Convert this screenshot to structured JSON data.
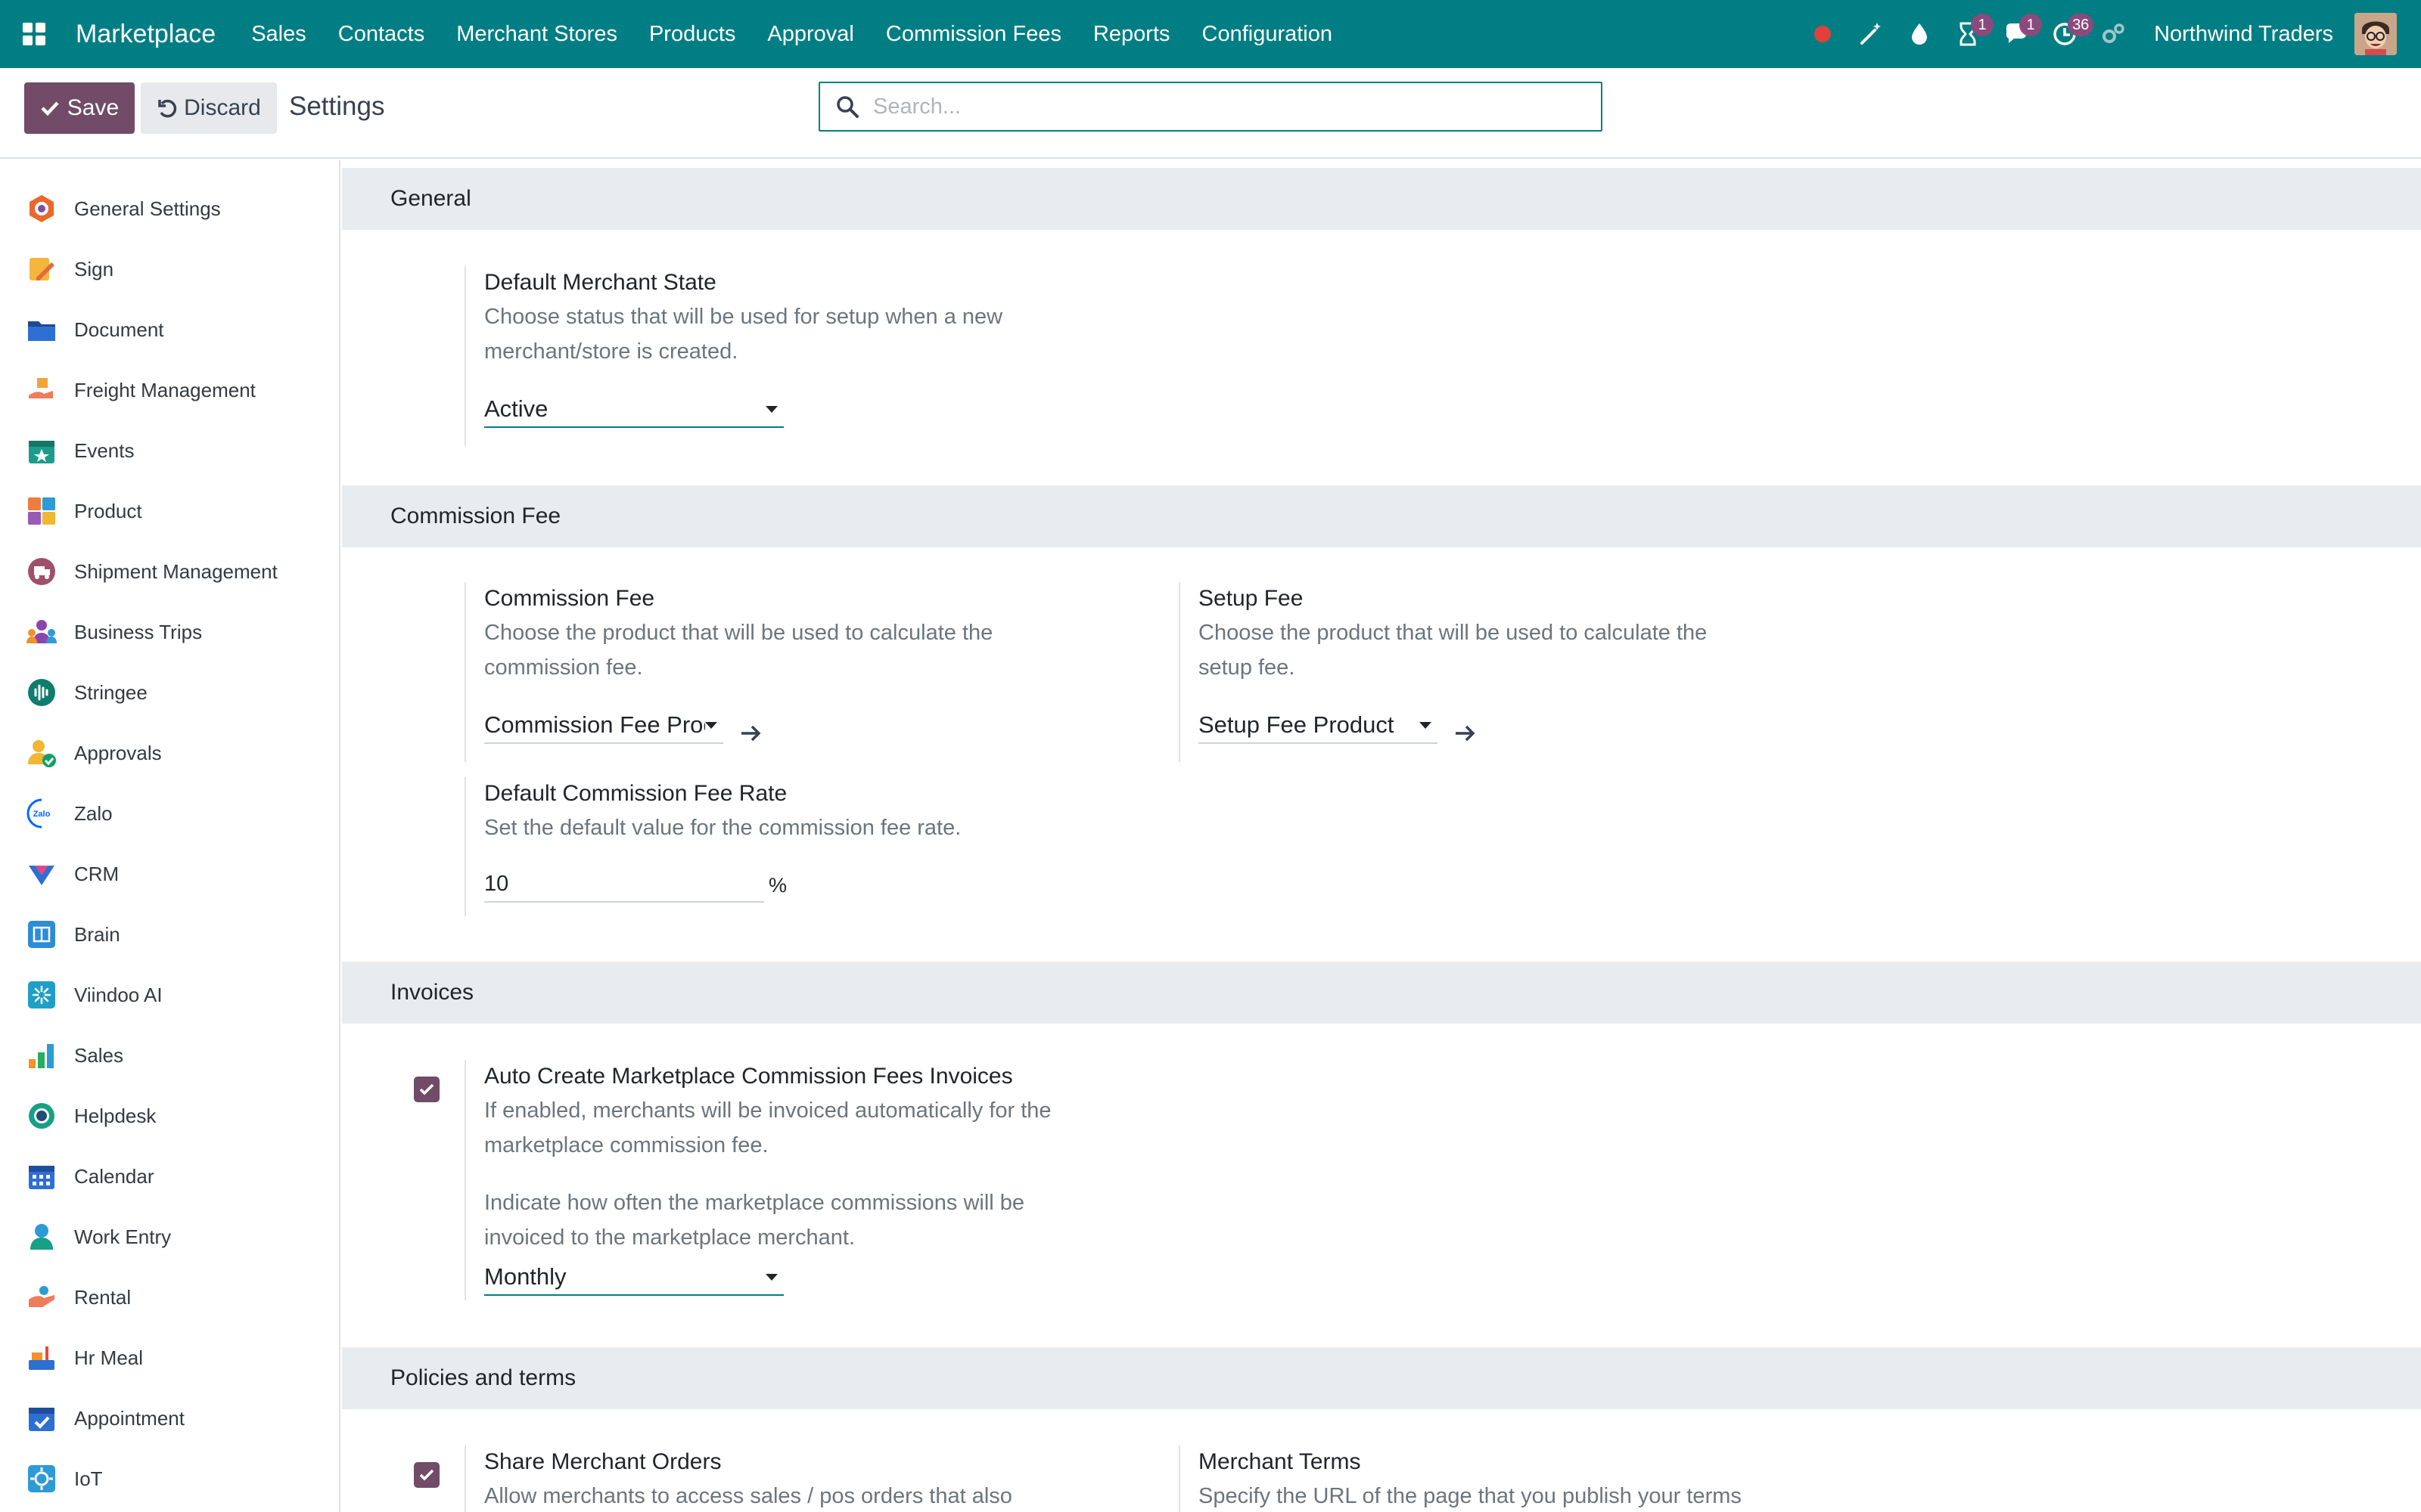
{
  "navbar": {
    "brand": "Marketplace",
    "menu": [
      "Sales",
      "Contacts",
      "Merchant Stores",
      "Products",
      "Approval",
      "Commission Fees",
      "Reports",
      "Configuration"
    ],
    "badges": {
      "activities_timer": "1",
      "messages": "1",
      "clock": "36"
    },
    "company": "Northwind Traders",
    "bg_color": "#017e84"
  },
  "control_panel": {
    "save_label": "Save",
    "discard_label": "Discard",
    "title": "Settings",
    "search_placeholder": "Search..."
  },
  "sidebar": {
    "items": [
      {
        "label": "General Settings",
        "icon": "general-settings-icon"
      },
      {
        "label": "Sign",
        "icon": "sign-icon"
      },
      {
        "label": "Document",
        "icon": "document-icon"
      },
      {
        "label": "Freight Management",
        "icon": "freight-icon"
      },
      {
        "label": "Events",
        "icon": "events-icon"
      },
      {
        "label": "Product",
        "icon": "product-icon"
      },
      {
        "label": "Shipment Management",
        "icon": "shipment-icon"
      },
      {
        "label": "Business Trips",
        "icon": "business-trips-icon"
      },
      {
        "label": "Stringee",
        "icon": "stringee-icon"
      },
      {
        "label": "Approvals",
        "icon": "approvals-icon"
      },
      {
        "label": "Zalo",
        "icon": "zalo-icon"
      },
      {
        "label": "CRM",
        "icon": "crm-icon"
      },
      {
        "label": "Brain",
        "icon": "brain-icon"
      },
      {
        "label": "Viindoo AI",
        "icon": "viindoo-ai-icon"
      },
      {
        "label": "Sales",
        "icon": "sales-icon"
      },
      {
        "label": "Helpdesk",
        "icon": "helpdesk-icon"
      },
      {
        "label": "Calendar",
        "icon": "calendar-icon"
      },
      {
        "label": "Work Entry",
        "icon": "work-entry-icon"
      },
      {
        "label": "Rental",
        "icon": "rental-icon"
      },
      {
        "label": "Hr Meal",
        "icon": "hr-meal-icon"
      },
      {
        "label": "Appointment",
        "icon": "appointment-icon"
      },
      {
        "label": "IoT",
        "icon": "iot-icon"
      }
    ]
  },
  "sections": {
    "general": {
      "title": "General",
      "default_merchant_state": {
        "title": "Default Merchant State",
        "desc_1": "Choose status that will be used for setup when a new",
        "desc_2": "merchant/store is created.",
        "value": "Active"
      }
    },
    "commission_fee": {
      "title": "Commission Fee",
      "commission_fee": {
        "title": "Commission Fee",
        "desc_1": "Choose the product that will be used to calculate the",
        "desc_2": "commission fee.",
        "value": "Commission Fee Proc"
      },
      "setup_fee": {
        "title": "Setup Fee",
        "desc_1": "Choose the product that will be used to calculate the",
        "desc_2": "setup fee.",
        "value": "Setup Fee Product"
      },
      "default_rate": {
        "title": "Default Commission Fee Rate",
        "desc": "Set the default value for the commission fee rate.",
        "value": "10",
        "unit": "%"
      }
    },
    "invoices": {
      "title": "Invoices",
      "auto_create": {
        "title": "Auto Create Marketplace Commission Fees Invoices",
        "desc_1": "If enabled, merchants will be invoiced automatically for the",
        "desc_2": "marketplace commission fee.",
        "desc_3": "Indicate how often the marketplace commissions will be",
        "desc_4": "invoiced to the marketplace merchant.",
        "checked": true,
        "frequency": "Monthly"
      }
    },
    "policies": {
      "title": "Policies and terms",
      "share_orders": {
        "title": "Share Merchant Orders",
        "desc_1": "Allow merchants to access sales / pos orders that also",
        "checked": true
      },
      "merchant_terms": {
        "title": "Merchant Terms",
        "desc_1": "Specify the URL of the page that you publish your terms"
      }
    }
  },
  "colors": {
    "primary": "#714b67",
    "navbar": "#017e84",
    "section_bg": "#e9ecef"
  }
}
